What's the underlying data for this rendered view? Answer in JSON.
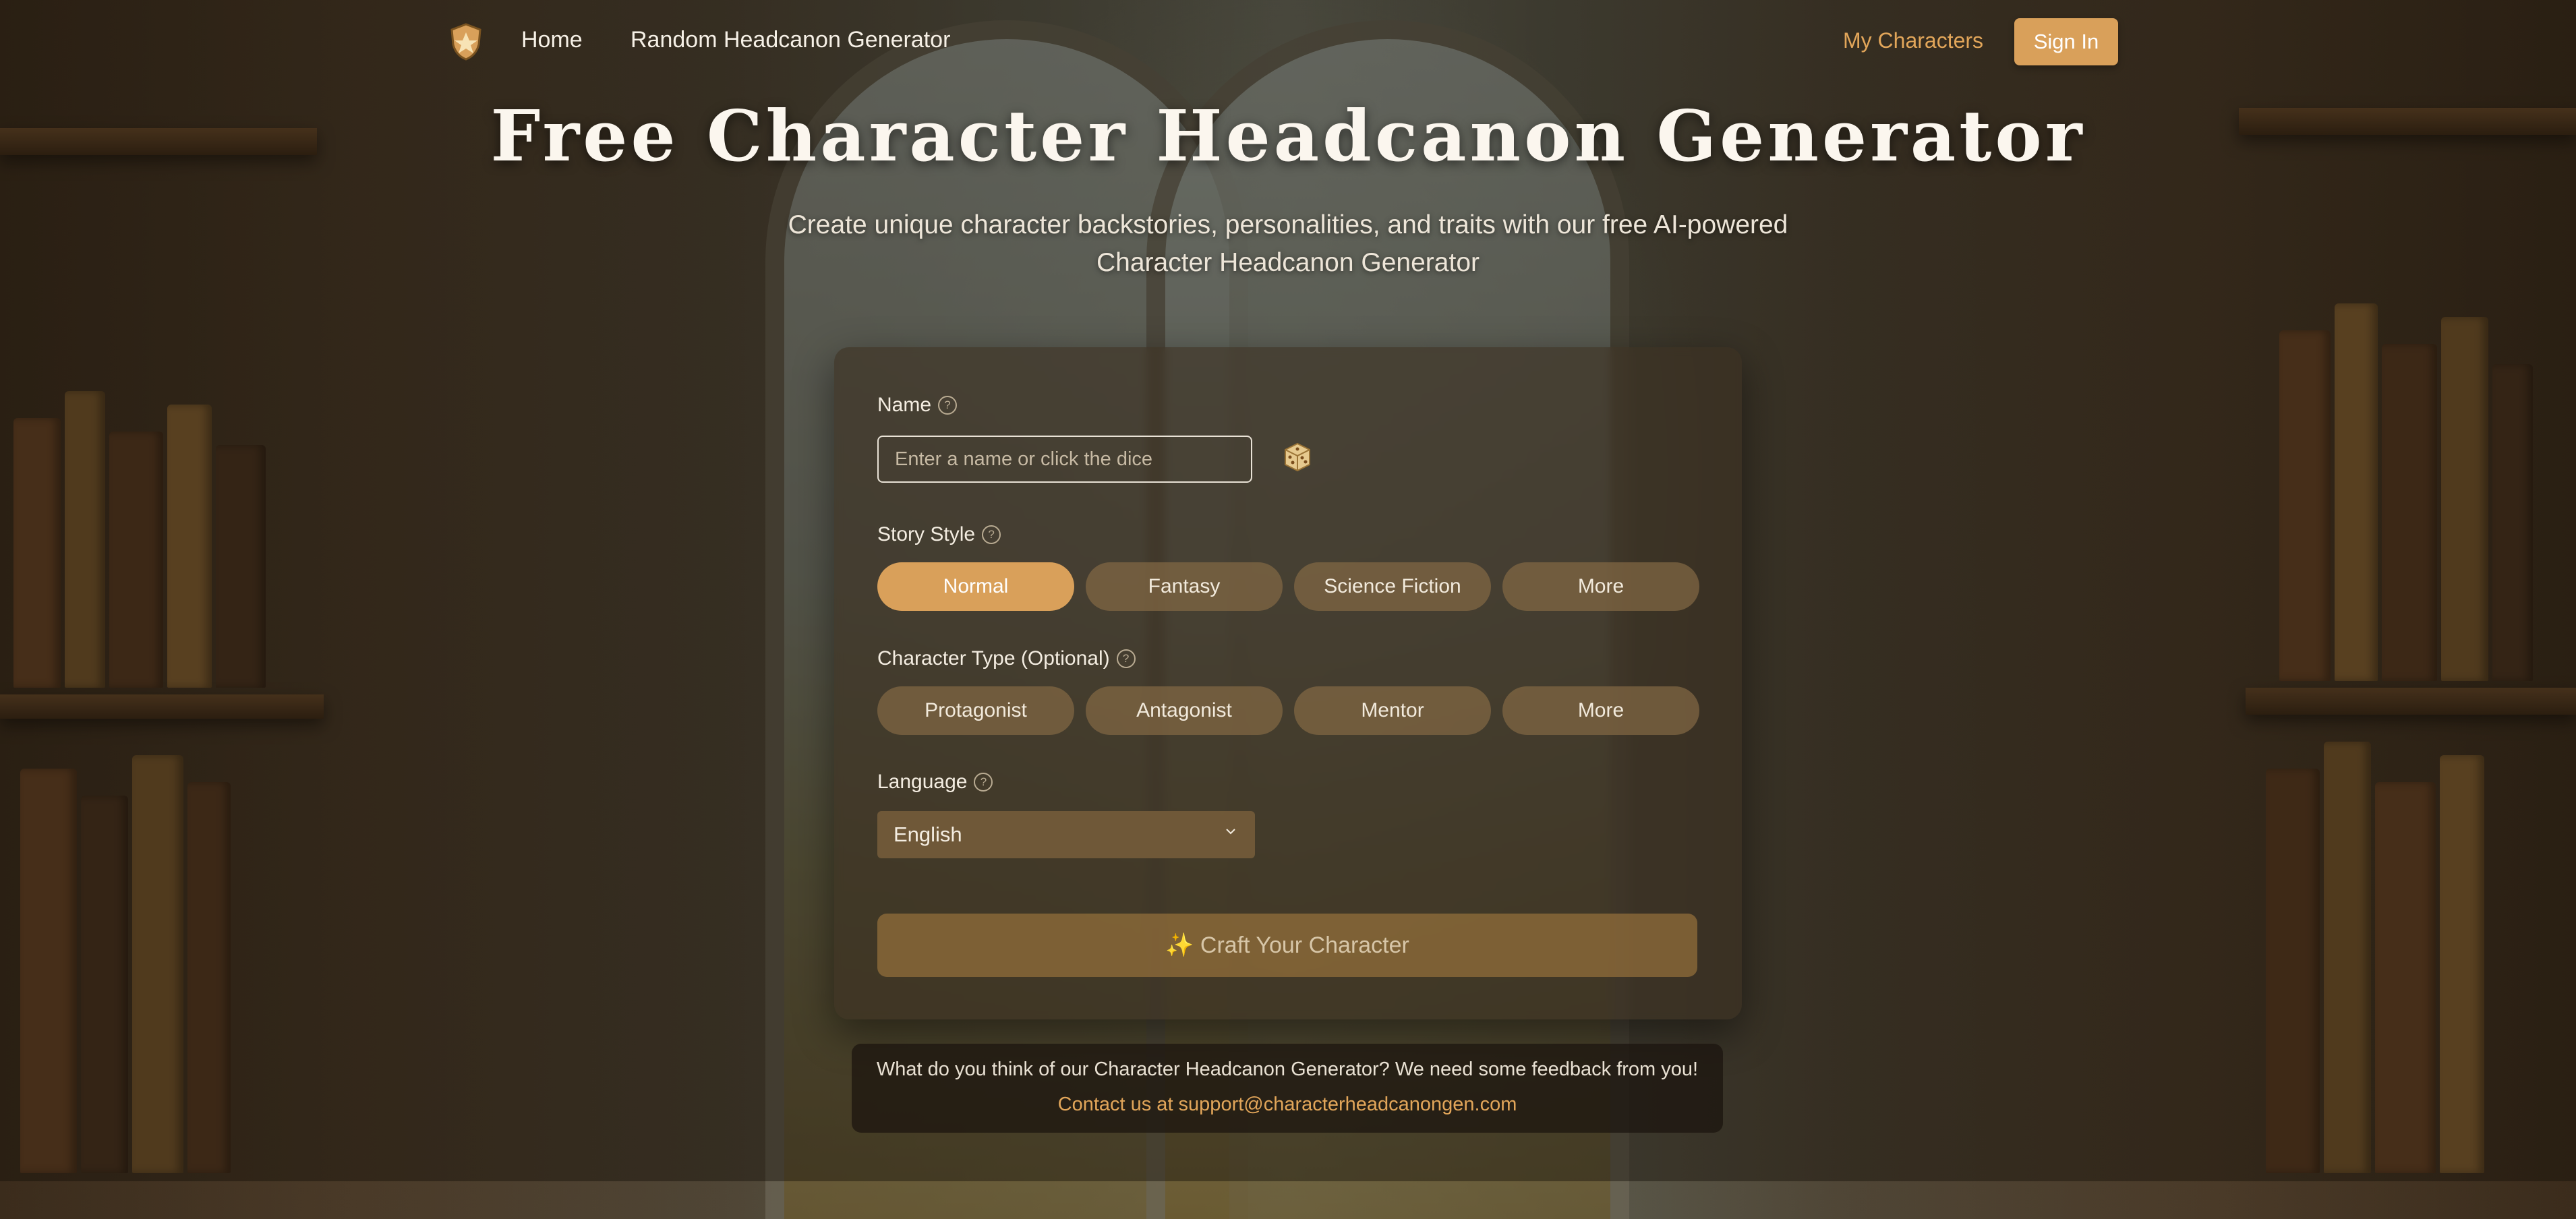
{
  "nav": {
    "logo_icon": "shield-logo-icon",
    "home": "Home",
    "random": "Random Headcanon Generator",
    "my_characters": "My Characters",
    "sign_in": "Sign In"
  },
  "hero": {
    "title": "Free Character Headcanon Generator",
    "subtitle": "Create unique character backstories, personalities, and traits with our free AI-powered Character Headcanon Generator"
  },
  "form": {
    "name_label": "Name",
    "name_placeholder": "Enter a name or click the dice",
    "name_value": "",
    "dice_icon": "dice-icon",
    "story_style_label": "Story Style",
    "story_styles": [
      "Normal",
      "Fantasy",
      "Science Fiction",
      "More"
    ],
    "story_style_selected": "Normal",
    "character_type_label": "Character Type (Optional)",
    "character_types": [
      "Protagonist",
      "Antagonist",
      "Mentor",
      "More"
    ],
    "language_label": "Language",
    "language_value": "English",
    "craft_button": "✨ Craft Your Character"
  },
  "feedback": {
    "text": "What do you think of our Character Headcanon Generator? We need some feedback from you!",
    "contact": "Contact us at support@characterheadcanongen.com"
  },
  "colors": {
    "accent": "#d9a05a",
    "link_accent": "#e2a65a"
  }
}
